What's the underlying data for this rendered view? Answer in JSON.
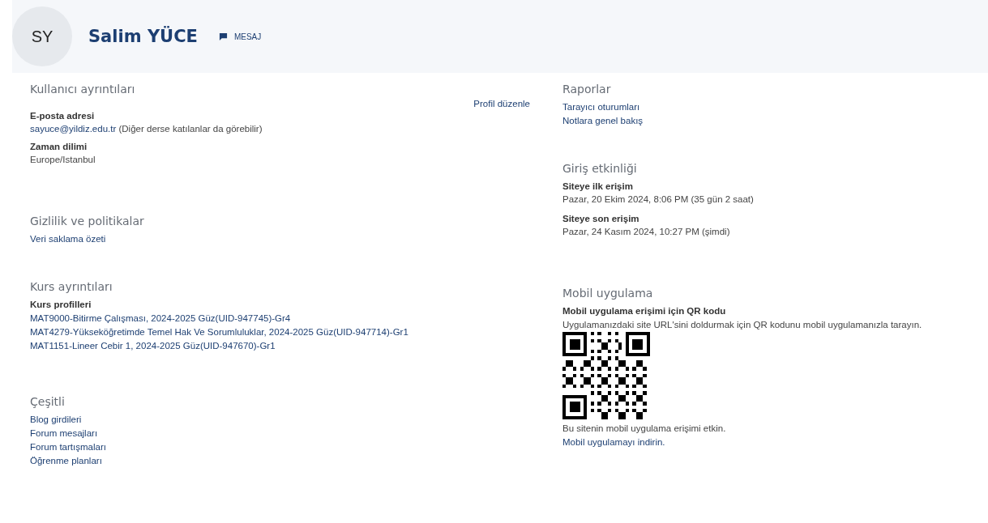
{
  "header": {
    "avatar_initials": "SY",
    "name": "Salim YÜCE",
    "message_button": "MESAJ"
  },
  "left_sections": [
    {
      "title": "Kullanıcı ayrıntıları",
      "action": "Profil düzenle",
      "items": [
        {
          "kind": "field_link",
          "label": "E-posta adresi",
          "link": "sayuce@yildiz.edu.tr",
          "note": "(Diğer derse katılanlar da görebilir)"
        },
        {
          "kind": "field",
          "label": "Zaman dilimi",
          "value": "Europe/Istanbul"
        }
      ]
    },
    {
      "title": "Gizlilik ve politikalar",
      "items": [
        {
          "kind": "link",
          "text": "Veri saklama özeti"
        }
      ]
    },
    {
      "title": "Kurs ayrıntıları",
      "items": [
        {
          "kind": "label",
          "text": "Kurs profilleri"
        },
        {
          "kind": "link",
          "text": "MAT9000-Bitirme Çalışması, 2024-2025 Güz(UID-947745)-Gr4"
        },
        {
          "kind": "link",
          "text": "MAT4279-Yükseköğretimde Temel Hak Ve Sorumluluklar, 2024-2025 Güz(UID-947714)-Gr1"
        },
        {
          "kind": "link",
          "text": "MAT1151-Lineer Cebir 1, 2024-2025 Güz(UID-947670)-Gr1"
        }
      ]
    },
    {
      "title": "Çeşitli",
      "items": [
        {
          "kind": "link",
          "text": "Blog girdileri"
        },
        {
          "kind": "link",
          "text": "Forum mesajları"
        },
        {
          "kind": "link",
          "text": "Forum tartışmaları"
        },
        {
          "kind": "link",
          "text": "Öğrenme planları"
        }
      ]
    }
  ],
  "right_sections": [
    {
      "title": "Raporlar",
      "items": [
        {
          "kind": "link",
          "text": "Tarayıcı oturumları"
        },
        {
          "kind": "link",
          "text": "Notlara genel bakış"
        }
      ]
    },
    {
      "title": "Giriş etkinliği",
      "items": [
        {
          "kind": "field",
          "label": "Siteye ilk erişim",
          "value": "Pazar, 20 Ekim 2024, 8:06 PM  (35 gün 2 saat)"
        },
        {
          "kind": "field",
          "label": "Siteye son erişim",
          "value": "Pazar, 24 Kasım 2024, 10:27 PM  (şimdi)"
        }
      ]
    },
    {
      "title": "Mobil uygulama",
      "items": [
        {
          "kind": "label",
          "text": "Mobil uygulama erişimi için QR kodu"
        },
        {
          "kind": "text",
          "text": "Uygulamanızdaki site URL'sini doldurmak için QR kodunu mobil uygulamanızla tarayın."
        },
        {
          "kind": "qr"
        },
        {
          "kind": "text",
          "text": "Bu sitenin mobil uygulama erişimi etkin."
        },
        {
          "kind": "link",
          "text": "Mobil uygulamayı indirin."
        }
      ]
    }
  ]
}
